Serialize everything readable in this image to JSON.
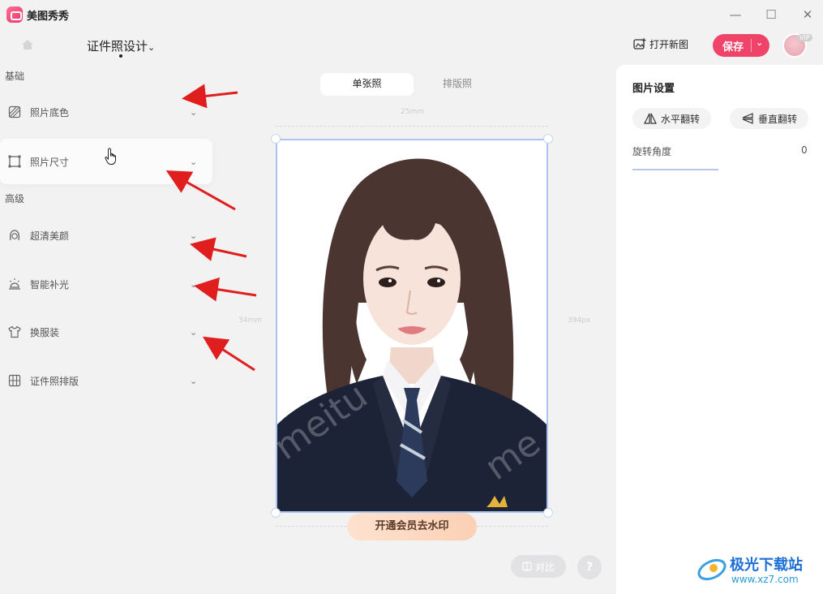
{
  "app": {
    "name": "美图秀秀"
  },
  "window": {
    "minimize": "—",
    "maximize": "☐",
    "close": "✕"
  },
  "header": {
    "title": "证件照设计",
    "title_chevron": "⌄",
    "open_new": "打开新图",
    "save": "保存",
    "vip_badge": "VIP"
  },
  "left_panel": {
    "section_basic": "基础",
    "section_advanced": "高级",
    "items": [
      {
        "label": "照片底色",
        "icon": "background-color-icon"
      },
      {
        "label": "照片尺寸",
        "icon": "crop-size-icon"
      },
      {
        "label": "超清美颜",
        "icon": "beauty-face-icon"
      },
      {
        "label": "智能补光",
        "icon": "light-fill-icon"
      },
      {
        "label": "换服装",
        "icon": "tshirt-icon"
      },
      {
        "label": "证件照排版",
        "icon": "grid-layout-icon"
      }
    ]
  },
  "canvas": {
    "tabs": [
      "单张照",
      "排版照"
    ],
    "dim_top": "25mm",
    "dim_left": "34mm",
    "dim_right": "394px",
    "watermark_button": "开通会员去水印",
    "compare_button": "对比",
    "help_button": "?"
  },
  "right_panel": {
    "title": "图片设置",
    "flip_horizontal": "水平翻转",
    "flip_vertical": "垂直翻转",
    "rotation_label": "旋转角度",
    "rotation_value": "0"
  },
  "site": {
    "title": "极光下载站",
    "url": "www.xz7.com"
  },
  "colors": {
    "accent": "#f0436a",
    "selection": "#a9c4ef",
    "arrow": "#e01e1e"
  }
}
